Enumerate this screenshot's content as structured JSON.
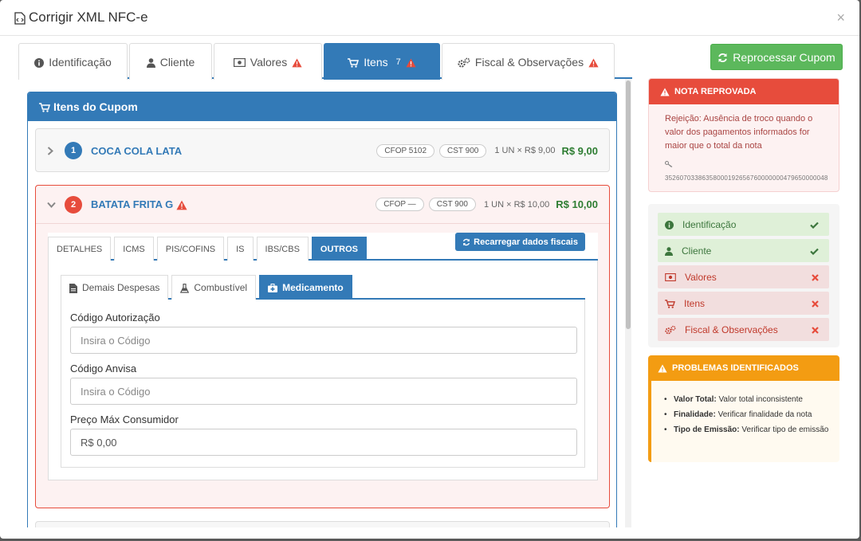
{
  "modal": {
    "title": "Corrigir XML NFC-e",
    "close": "×"
  },
  "main_tabs": [
    {
      "label": "Identificação",
      "icon": "info-icon",
      "warning": false
    },
    {
      "label": "Cliente",
      "icon": "user-icon",
      "warning": false
    },
    {
      "label": "Valores",
      "icon": "money-icon",
      "warning": true
    },
    {
      "label": "Itens",
      "icon": "cart-icon",
      "count": "7",
      "warning": true,
      "active": true
    },
    {
      "label": "Fiscal & Observações",
      "icon": "gears-icon",
      "warning": true
    }
  ],
  "reprocess_button": "Reprocessar Cupom",
  "items_panel": {
    "title": "Itens do Cupom",
    "items": [
      {
        "num": "1",
        "name": "COCA COLA LATA",
        "cfop": "CFOP 5102",
        "cst": "CST 900",
        "qty": "1 UN × R$ 9,00",
        "price": "R$ 9,00"
      },
      {
        "num": "2",
        "name": "BATATA FRITA G",
        "cfop": "CFOP —",
        "cst": "CST 900",
        "qty": "1 UN × R$ 10,00",
        "price": "R$ 10,00"
      }
    ]
  },
  "sub_tabs": [
    "DETALHES",
    "ICMS",
    "PIS/COFINS",
    "IS",
    "IBS/CBS",
    "OUTROS"
  ],
  "reload_button": "Recarregar dados fiscais",
  "inner_tabs": [
    "Demais Despesas",
    "Combustível",
    "Medicamento"
  ],
  "form": {
    "auth_label": "Código Autorização",
    "auth_placeholder": "Insira o Código",
    "anvisa_label": "Código Anvisa",
    "anvisa_placeholder": "Insira o Código",
    "pmc_label": "Preço Máx Consumidor",
    "pmc_value": "R$ 0,00"
  },
  "reject": {
    "title": "NOTA REPROVADA",
    "message": "Rejeição: Ausência de troco quando o valor dos pagamentos informados for maior que o total da nota",
    "key": "35260703386358000192656760000000479650000048"
  },
  "checklist": [
    {
      "label": "Identificação",
      "status": "ok",
      "icon": "info-icon"
    },
    {
      "label": "Cliente",
      "status": "ok",
      "icon": "user-icon"
    },
    {
      "label": "Valores",
      "status": "bad",
      "icon": "money-icon"
    },
    {
      "label": "Itens",
      "status": "bad",
      "icon": "cart-icon"
    },
    {
      "label": "Fiscal & Observações",
      "status": "bad",
      "icon": "gears-icon"
    }
  ],
  "problems": {
    "title": "PROBLEMAS IDENTIFICADOS",
    "list": [
      {
        "key": "Valor Total:",
        "text": "Valor total inconsistente"
      },
      {
        "key": "Finalidade:",
        "text": "Verificar finalidade da nota"
      },
      {
        "key": "Tipo de Emissão:",
        "text": "Verificar tipo de emissão"
      }
    ]
  },
  "colors": {
    "primary": "#337ab7",
    "success": "#5cb85c",
    "danger": "#e74c3c",
    "warning": "#f39c12"
  }
}
